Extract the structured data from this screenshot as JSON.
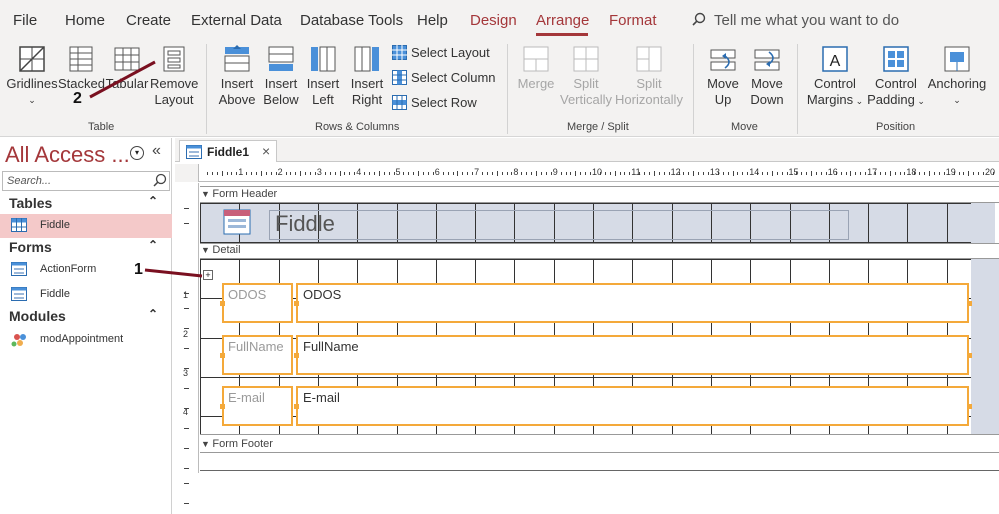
{
  "menubar": {
    "items": [
      "File",
      "Home",
      "Create",
      "External Data",
      "Database Tools",
      "Help",
      "Design",
      "Arrange",
      "Format"
    ],
    "tell_me": "Tell me what you want to do"
  },
  "ribbon": {
    "table": {
      "gridlines": "Gridlines",
      "stacked": "Stacked",
      "tabular": "Tabular",
      "remove_layout": [
        "Remove",
        "Layout"
      ],
      "label": "Table"
    },
    "rows_columns": {
      "insert_above": [
        "Insert",
        "Above"
      ],
      "insert_below": [
        "Insert",
        "Below"
      ],
      "insert_left": [
        "Insert",
        "Left"
      ],
      "insert_right": [
        "Insert",
        "Right"
      ],
      "select_layout": "Select Layout",
      "select_column": "Select Column",
      "select_row": "Select Row",
      "label": "Rows & Columns"
    },
    "merge_split": {
      "merge": "Merge",
      "split_vertically": [
        "Split",
        "Vertically"
      ],
      "split_horizontally": [
        "Split",
        "Horizontally"
      ],
      "label": "Merge / Split"
    },
    "move": {
      "move_up": [
        "Move",
        "Up"
      ],
      "move_down": [
        "Move",
        "Down"
      ],
      "label": "Move"
    },
    "position": {
      "control_margins": [
        "Control",
        "Margins"
      ],
      "control_padding": [
        "Control",
        "Padding"
      ],
      "anchoring": "Anchoring",
      "label": "Position"
    }
  },
  "nav": {
    "title": "All Access ...",
    "search_placeholder": "Search...",
    "groups": [
      {
        "title": "Tables",
        "items": [
          "Fiddle"
        ]
      },
      {
        "title": "Forms",
        "items": [
          "ActionForm",
          "Fiddle"
        ]
      },
      {
        "title": "Modules",
        "items": [
          "modAppointment"
        ]
      }
    ]
  },
  "document": {
    "tab": "Fiddle1",
    "ruler_numbers": [
      "1",
      "2",
      "3",
      "4",
      "5",
      "6",
      "7",
      "8",
      "9",
      "10",
      "11",
      "12",
      "13",
      "14",
      "15",
      "16",
      "17",
      "18",
      "19",
      "20"
    ],
    "vruler_numbers": [
      "1",
      "2",
      "3",
      "4"
    ],
    "form_header": "Form Header",
    "form_title": "Fiddle",
    "detail": "Detail",
    "form_footer": "Form Footer",
    "fields": [
      {
        "label": "ODOS",
        "value": "ODOS"
      },
      {
        "label": "FullName",
        "value": "FullName"
      },
      {
        "label": "E-mail",
        "value": "E-mail"
      }
    ]
  },
  "annotations": {
    "one": "1",
    "two": "2"
  },
  "colors": {
    "accent": "#a4373a",
    "selection": "#f4a93a",
    "nav_selected": "#f4c9c9"
  }
}
